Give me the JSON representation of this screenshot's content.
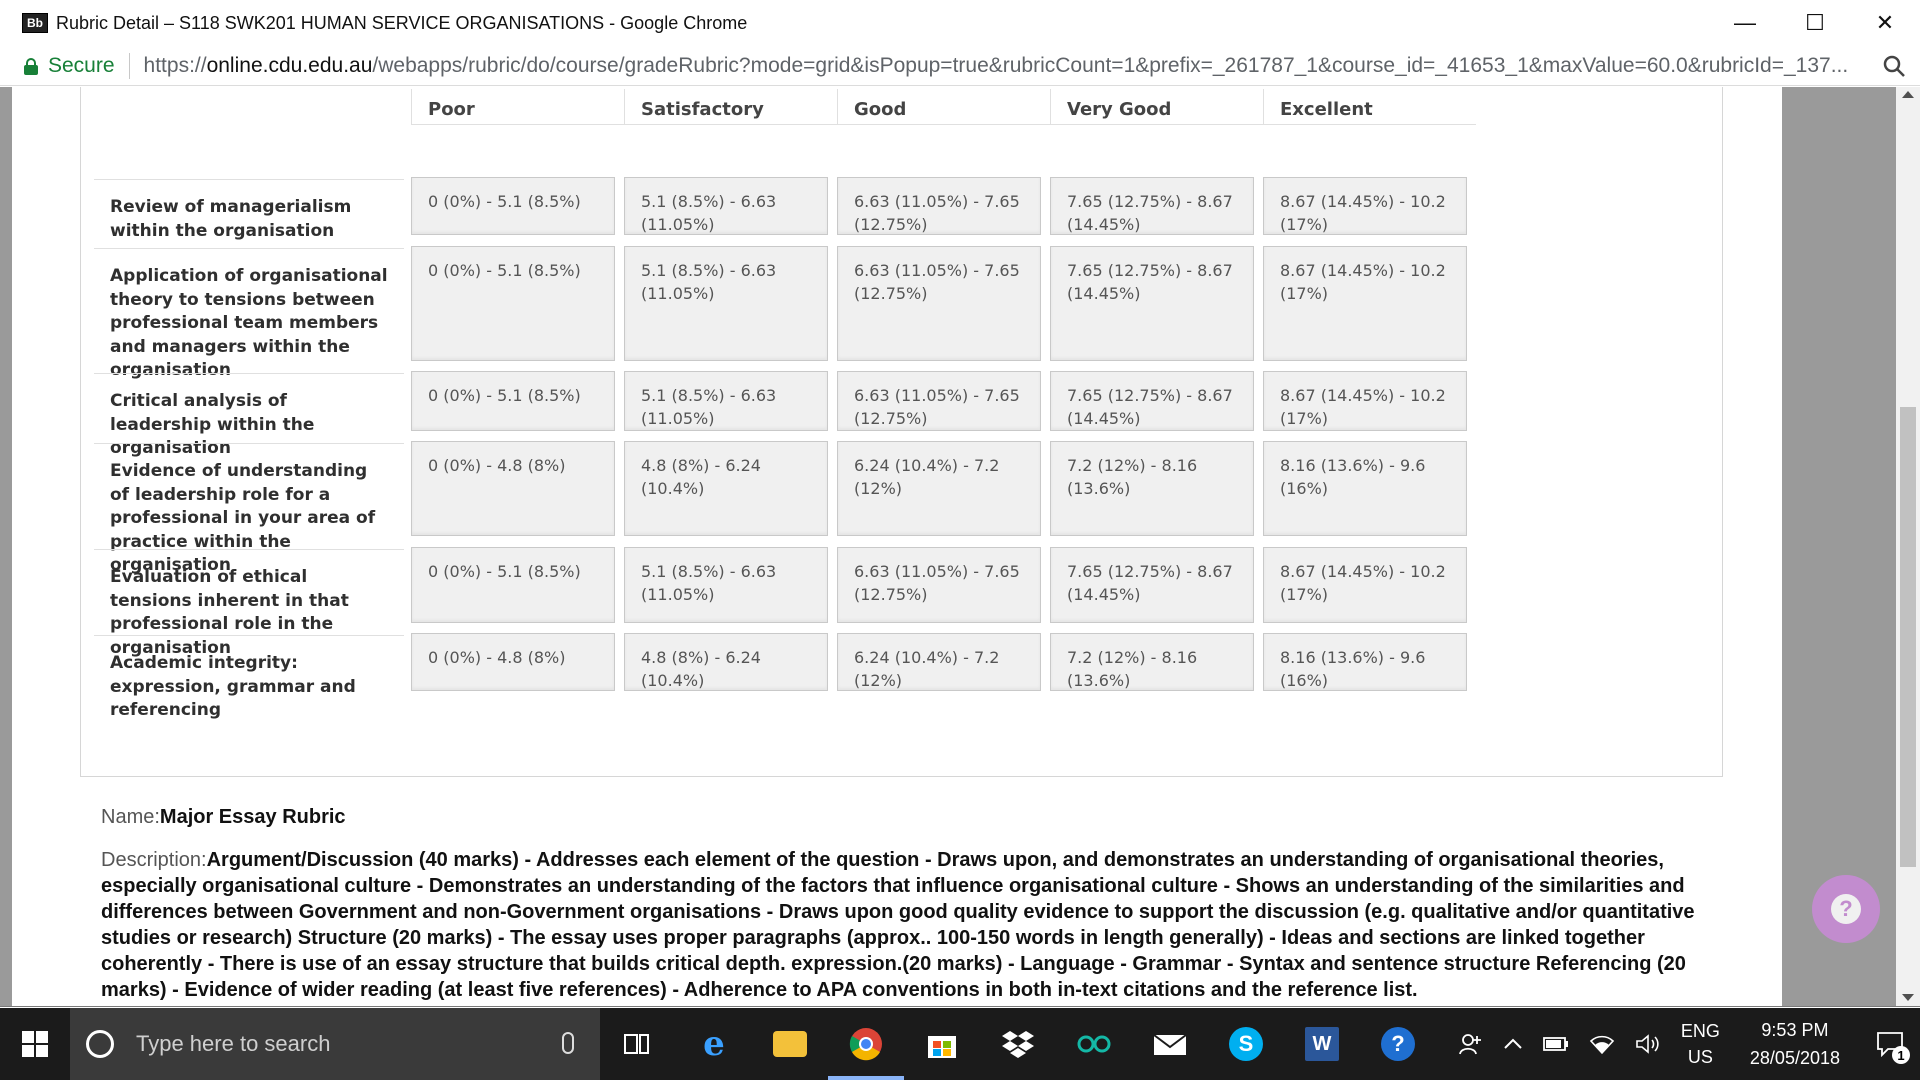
{
  "window": {
    "favicon_text": "Bb",
    "title": "Rubric Detail – S118 SWK201 HUMAN SERVICE ORGANISATIONS - Google Chrome",
    "minimize": "—",
    "maximize": "☐",
    "close": "✕"
  },
  "addressbar": {
    "secure_label": "Secure",
    "url_scheme": "https://",
    "url_host": "online.cdu.edu.au",
    "url_path": "/webapps/rubric/do/course/gradeRubric?mode=grid&isPopup=true&rubricCount=1&prefix=_261787_1&course_id=_41653_1&maxValue=60.0&rubricId=_137..."
  },
  "rubric": {
    "columns": [
      "Poor",
      "Satisfactory",
      "Good",
      "Very Good",
      "Excellent"
    ],
    "rows": [
      {
        "criterion": "Review of managerialism within the organisation",
        "cells": [
          "0 (0%) - 5.1 (8.5%)",
          "5.1 (8.5%) - 6.63 (11.05%)",
          "6.63 (11.05%) - 7.65 (12.75%)",
          "7.65 (12.75%) - 8.67 (14.45%)",
          "8.67 (14.45%) - 10.2 (17%)"
        ]
      },
      {
        "criterion": "Application of organisational theory to tensions between professional team members and managers within the organisation",
        "cells": [
          "0 (0%) - 5.1 (8.5%)",
          "5.1 (8.5%) - 6.63 (11.05%)",
          "6.63 (11.05%) - 7.65 (12.75%)",
          "7.65 (12.75%) - 8.67 (14.45%)",
          "8.67 (14.45%) - 10.2 (17%)"
        ]
      },
      {
        "criterion": "Critical analysis of leadership within the organisation",
        "cells": [
          "0 (0%) - 5.1 (8.5%)",
          "5.1 (8.5%) - 6.63 (11.05%)",
          "6.63 (11.05%) - 7.65 (12.75%)",
          "7.65 (12.75%) - 8.67 (14.45%)",
          "8.67 (14.45%) - 10.2 (17%)"
        ]
      },
      {
        "criterion": "Evidence of understanding of leadership role for a professional in your area of practice within the organisation",
        "cells": [
          "0 (0%) - 4.8 (8%)",
          "4.8 (8%) - 6.24 (10.4%)",
          "6.24 (10.4%) - 7.2 (12%)",
          "7.2 (12%) - 8.16 (13.6%)",
          "8.16 (13.6%) - 9.6 (16%)"
        ]
      },
      {
        "criterion": "Evaluation of ethical tensions inherent in that professional role in the organisation",
        "cells": [
          "0 (0%) - 5.1 (8.5%)",
          "5.1 (8.5%) - 6.63 (11.05%)",
          "6.63 (11.05%) - 7.65 (12.75%)",
          "7.65 (12.75%) - 8.67 (14.45%)",
          "8.67 (14.45%) - 10.2 (17%)"
        ]
      },
      {
        "criterion": "Academic integrity: expression, grammar and referencing",
        "cells": [
          "0 (0%) - 4.8 (8%)",
          "4.8 (8%) - 6.24 (10.4%)",
          "6.24 (10.4%) - 7.2 (12%)",
          "7.2 (12%) - 8.16 (13.6%)",
          "8.16 (13.6%) - 9.6 (16%)"
        ]
      }
    ]
  },
  "details": {
    "name_label": "Name:",
    "name_value": "Major Essay Rubric",
    "description_label": "Description:",
    "description_value": "Argument/Discussion (40 marks) - Addresses each element of the question - Draws upon, and demonstrates an understanding of organisational theories, especially organisational culture - Demonstrates an understanding of the factors that influence organisational culture - Shows an understanding of the similarities and differences between Government and non-Government organisations - Draws upon good quality evidence to support the discussion (e.g. qualitative and/or quantitative studies or research) Structure (20 marks) - The essay uses proper paragraphs (approx.. 100-150 words in length generally) - Ideas and sections are linked together coherently - There is use of an essay structure that builds critical depth. expression.(20 marks) - Language - Grammar  - Syntax and sentence structure Referencing (20 marks) - Evidence of wider reading (at least five references) - Adherence to APA conventions in both in-text citations and the reference list."
  },
  "help_button": "?",
  "taskbar": {
    "search_placeholder": "Type here to search",
    "apps": [
      "task-view",
      "edge",
      "file-explorer",
      "chrome",
      "store",
      "dropbox",
      "arduino",
      "mail",
      "skype",
      "word",
      "help"
    ],
    "lang_top": "ENG",
    "lang_bottom": "US",
    "time": "9:53 PM",
    "date": "28/05/2018",
    "notification_count": "1"
  },
  "colors": {
    "secure_green": "#188038",
    "cell_bg": "#f0f0f0",
    "taskbar_bg": "#1b1b1b",
    "help_fab": "#c98ad8"
  }
}
